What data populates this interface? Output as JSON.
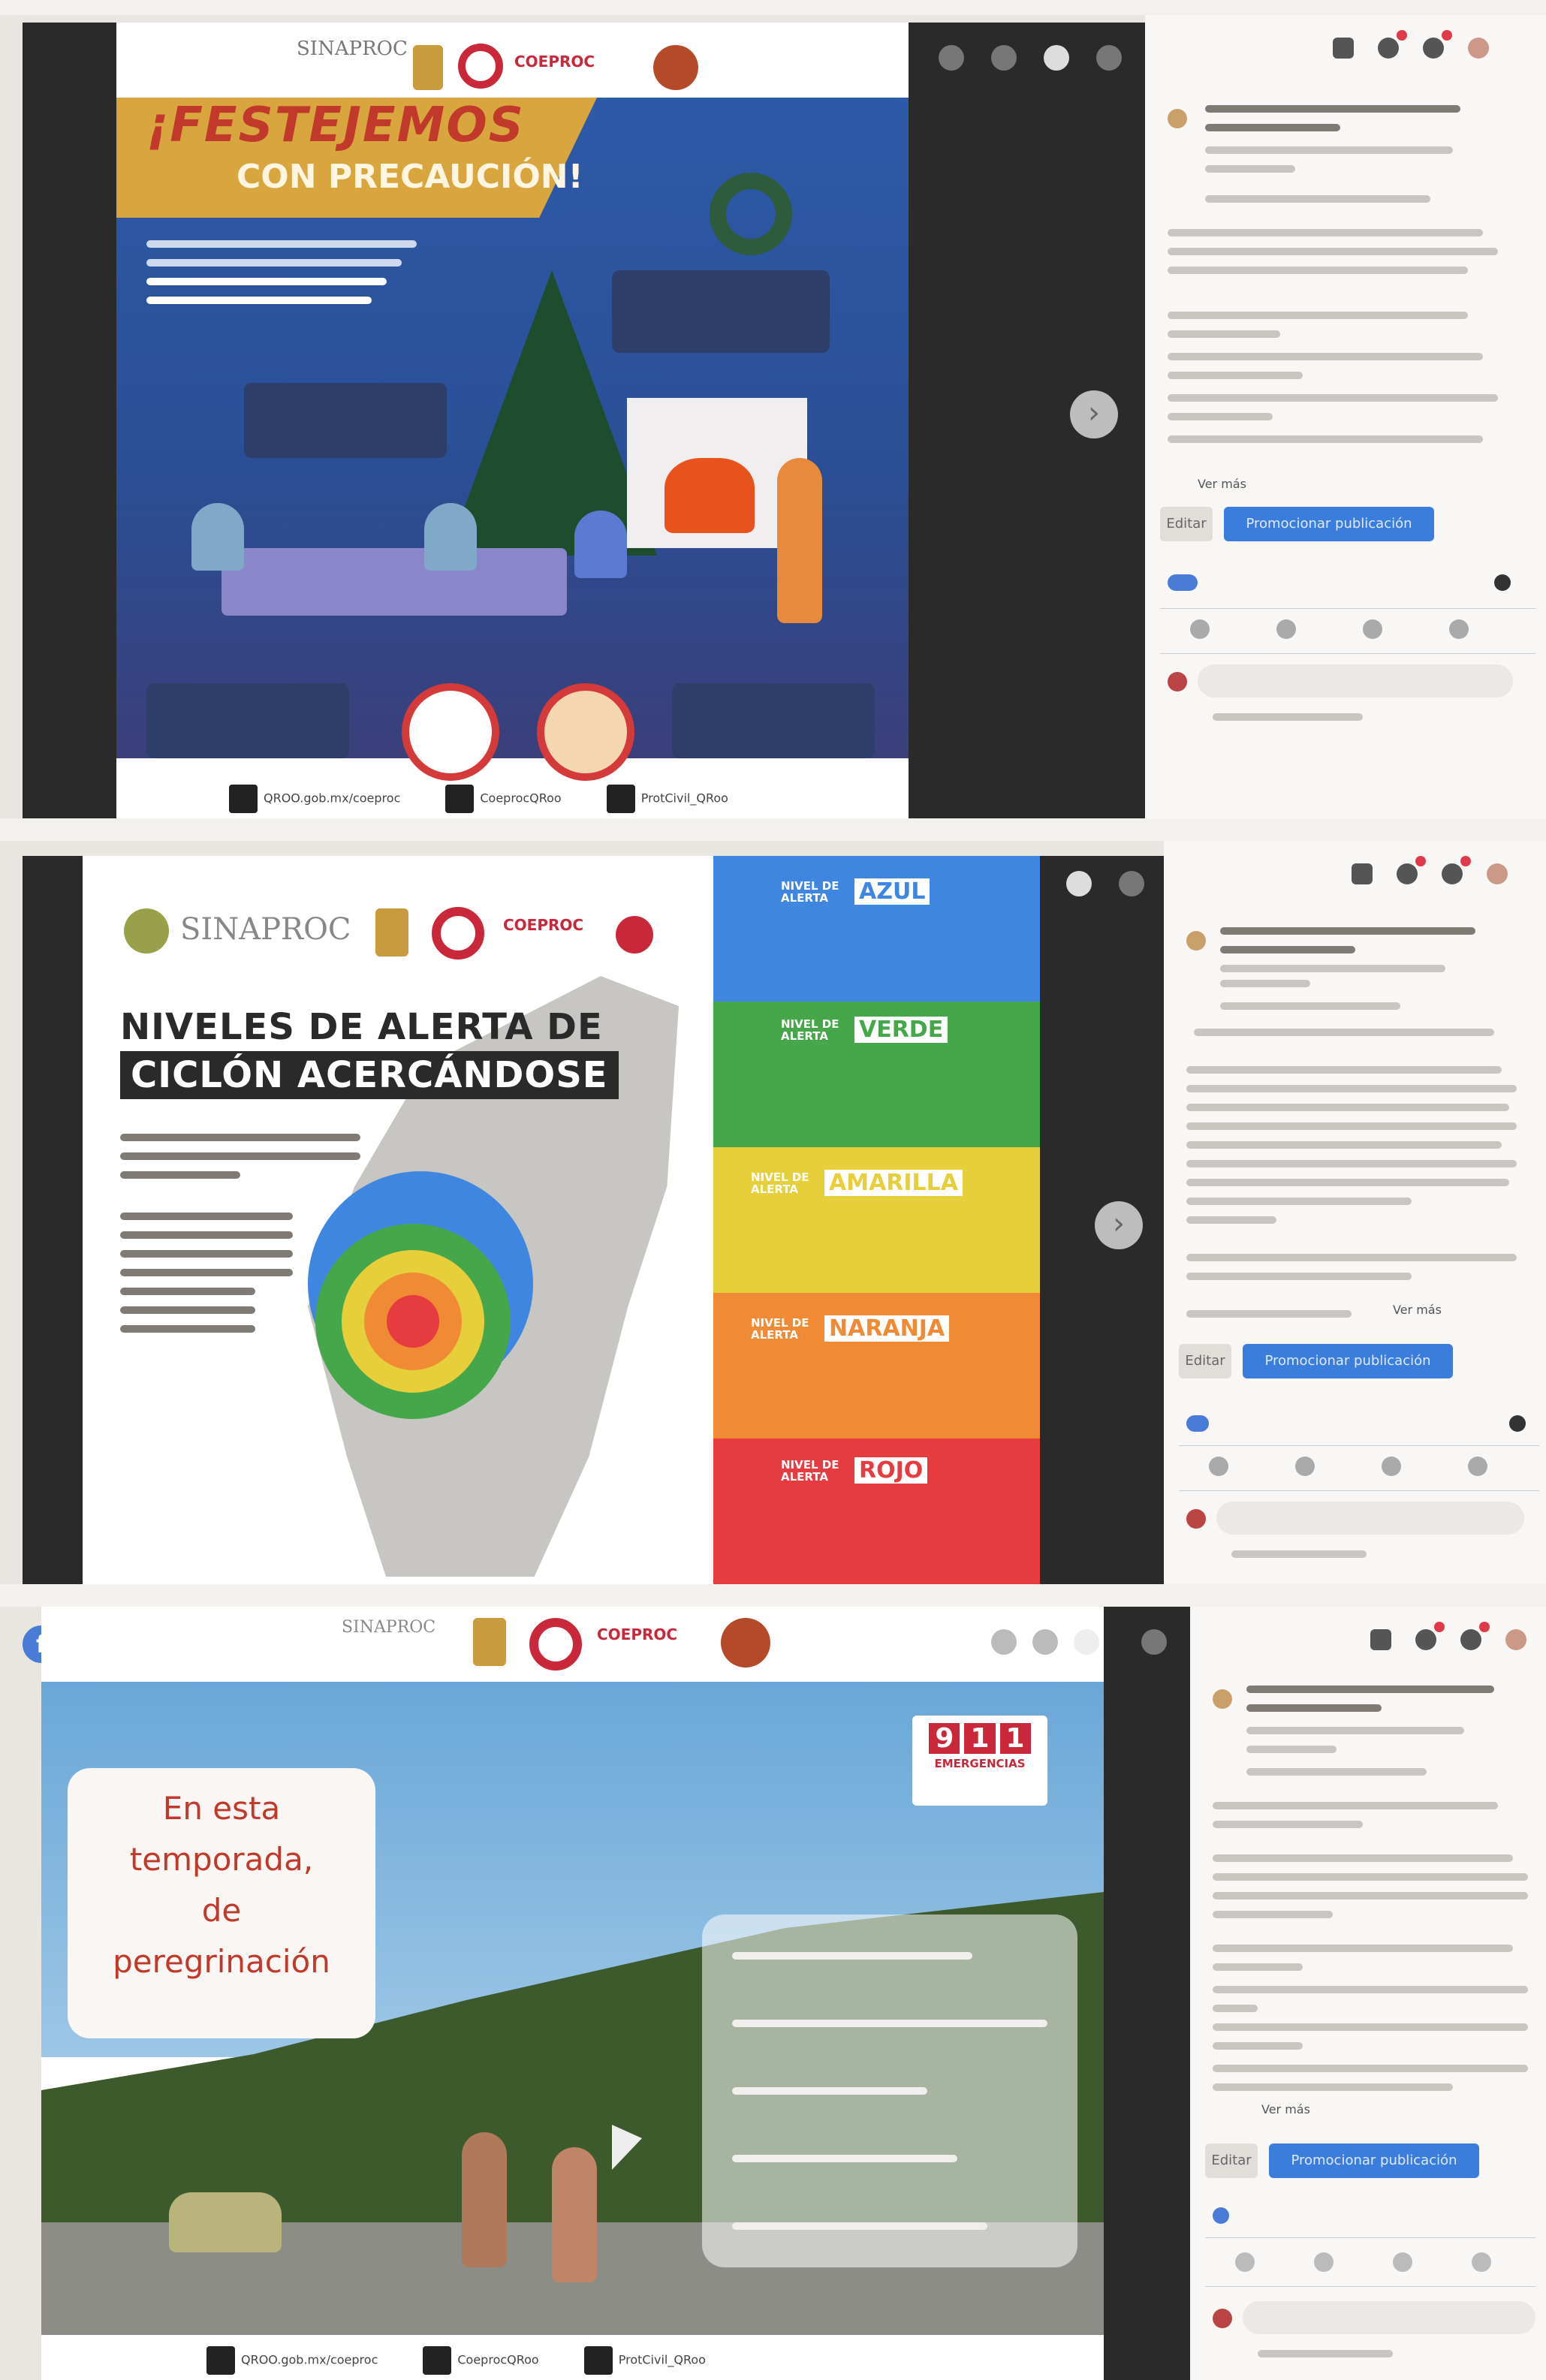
{
  "panel1": {
    "poster": {
      "title_line1": "¡FESTEJEMOS",
      "title_line2": "CON PRECAUCIÓN!"
    },
    "logos": {
      "sinaproc": "SINAPROC",
      "coeproc": "COEPROC"
    },
    "footer": {
      "youtube": "QROO.gob.mx/coeproc",
      "facebook": "CoeprocQRoo",
      "twitter": "ProtCivil_QRoo"
    },
    "post": {
      "see_more": "Ver más",
      "edit_button": "Editar",
      "promote_button": "Promocionar publicación"
    }
  },
  "panel2": {
    "logos": {
      "sinaproc": "SINAPROC",
      "coeproc": "COEPROC"
    },
    "poster": {
      "title_line1": "NIVELES DE ALERTA DE",
      "title_line2": "CICLÓN ACERCÁNDOSE",
      "alert_prefix": "NIVEL DE ALERTA",
      "levels": [
        {
          "name": "AZUL",
          "color": "#3f86e0"
        },
        {
          "name": "VERDE",
          "color": "#46a64a"
        },
        {
          "name": "AMARILLA",
          "color": "#e7cf3b"
        },
        {
          "name": "NARANJA",
          "color": "#f08a34"
        },
        {
          "name": "ROJO",
          "color": "#e63b3f"
        }
      ]
    },
    "post": {
      "see_more": "Ver más",
      "edit_button": "Editar",
      "promote_button": "Promocionar publicación"
    }
  },
  "panel3": {
    "logos": {
      "sinaproc": "SINAPROC",
      "coeproc": "COEPROC"
    },
    "poster": {
      "line1": "En esta",
      "line2": "temporada,",
      "line3": "de",
      "line4": "peregrinación",
      "emergency_number": [
        "9",
        "1",
        "1"
      ],
      "emergency_label": "EMERGENCIAS"
    },
    "footer": {
      "youtube": "QROO.gob.mx/coeproc",
      "facebook": "CoeprocQRoo",
      "twitter": "ProtCivil_QRoo"
    },
    "post": {
      "see_more": "Ver más",
      "edit_button": "Editar",
      "promote_button": "Promocionar publicación"
    }
  }
}
